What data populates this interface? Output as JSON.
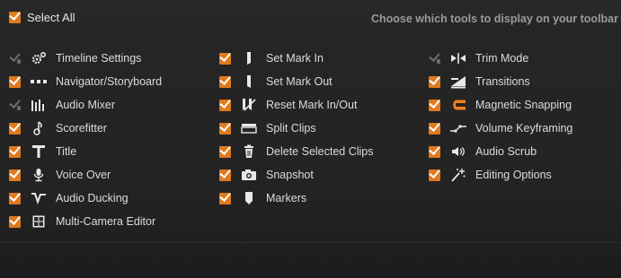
{
  "header": {
    "select_all_label": "Select All",
    "hint": "Choose which tools to display on your toolbar"
  },
  "columns": [
    {
      "items": [
        {
          "label": "Timeline Settings",
          "checked": false,
          "icon": "gear-icon"
        },
        {
          "label": "Navigator/Storyboard",
          "checked": true,
          "icon": "dots-icon"
        },
        {
          "label": "Audio Mixer",
          "checked": false,
          "icon": "audio-mixer-icon"
        },
        {
          "label": "Scorefitter",
          "checked": true,
          "icon": "music-note-icon"
        },
        {
          "label": "Title",
          "checked": true,
          "icon": "title-icon"
        },
        {
          "label": "Voice Over",
          "checked": true,
          "icon": "microphone-icon"
        },
        {
          "label": "Audio Ducking",
          "checked": true,
          "icon": "ducking-icon"
        },
        {
          "label": "Multi-Camera Editor",
          "checked": true,
          "icon": "multicam-icon"
        }
      ]
    },
    {
      "items": [
        {
          "label": "Set Mark In",
          "checked": true,
          "icon": "mark-in-icon"
        },
        {
          "label": "Set Mark Out",
          "checked": true,
          "icon": "mark-out-icon"
        },
        {
          "label": "Reset Mark In/Out",
          "checked": true,
          "icon": "reset-mark-icon"
        },
        {
          "label": "Split Clips",
          "checked": true,
          "icon": "split-icon"
        },
        {
          "label": "Delete Selected Clips",
          "checked": true,
          "icon": "trash-icon"
        },
        {
          "label": "Snapshot",
          "checked": true,
          "icon": "camera-icon"
        },
        {
          "label": "Markers",
          "checked": true,
          "icon": "marker-icon"
        }
      ]
    },
    {
      "items": [
        {
          "label": "Trim Mode",
          "checked": false,
          "icon": "trim-icon"
        },
        {
          "label": "Transitions",
          "checked": true,
          "icon": "transitions-icon"
        },
        {
          "label": "Magnetic Snapping",
          "checked": true,
          "icon": "magnet-icon"
        },
        {
          "label": "Volume Keyframing",
          "checked": true,
          "icon": "keyframe-icon"
        },
        {
          "label": "Audio Scrub",
          "checked": true,
          "icon": "speaker-icon"
        },
        {
          "label": "Editing Options",
          "checked": true,
          "icon": "wand-icon"
        }
      ]
    }
  ],
  "colors": {
    "accent": "#e07a1f",
    "background": "#242424",
    "text": "#dcdcdc",
    "hint": "#9a9a9a"
  }
}
